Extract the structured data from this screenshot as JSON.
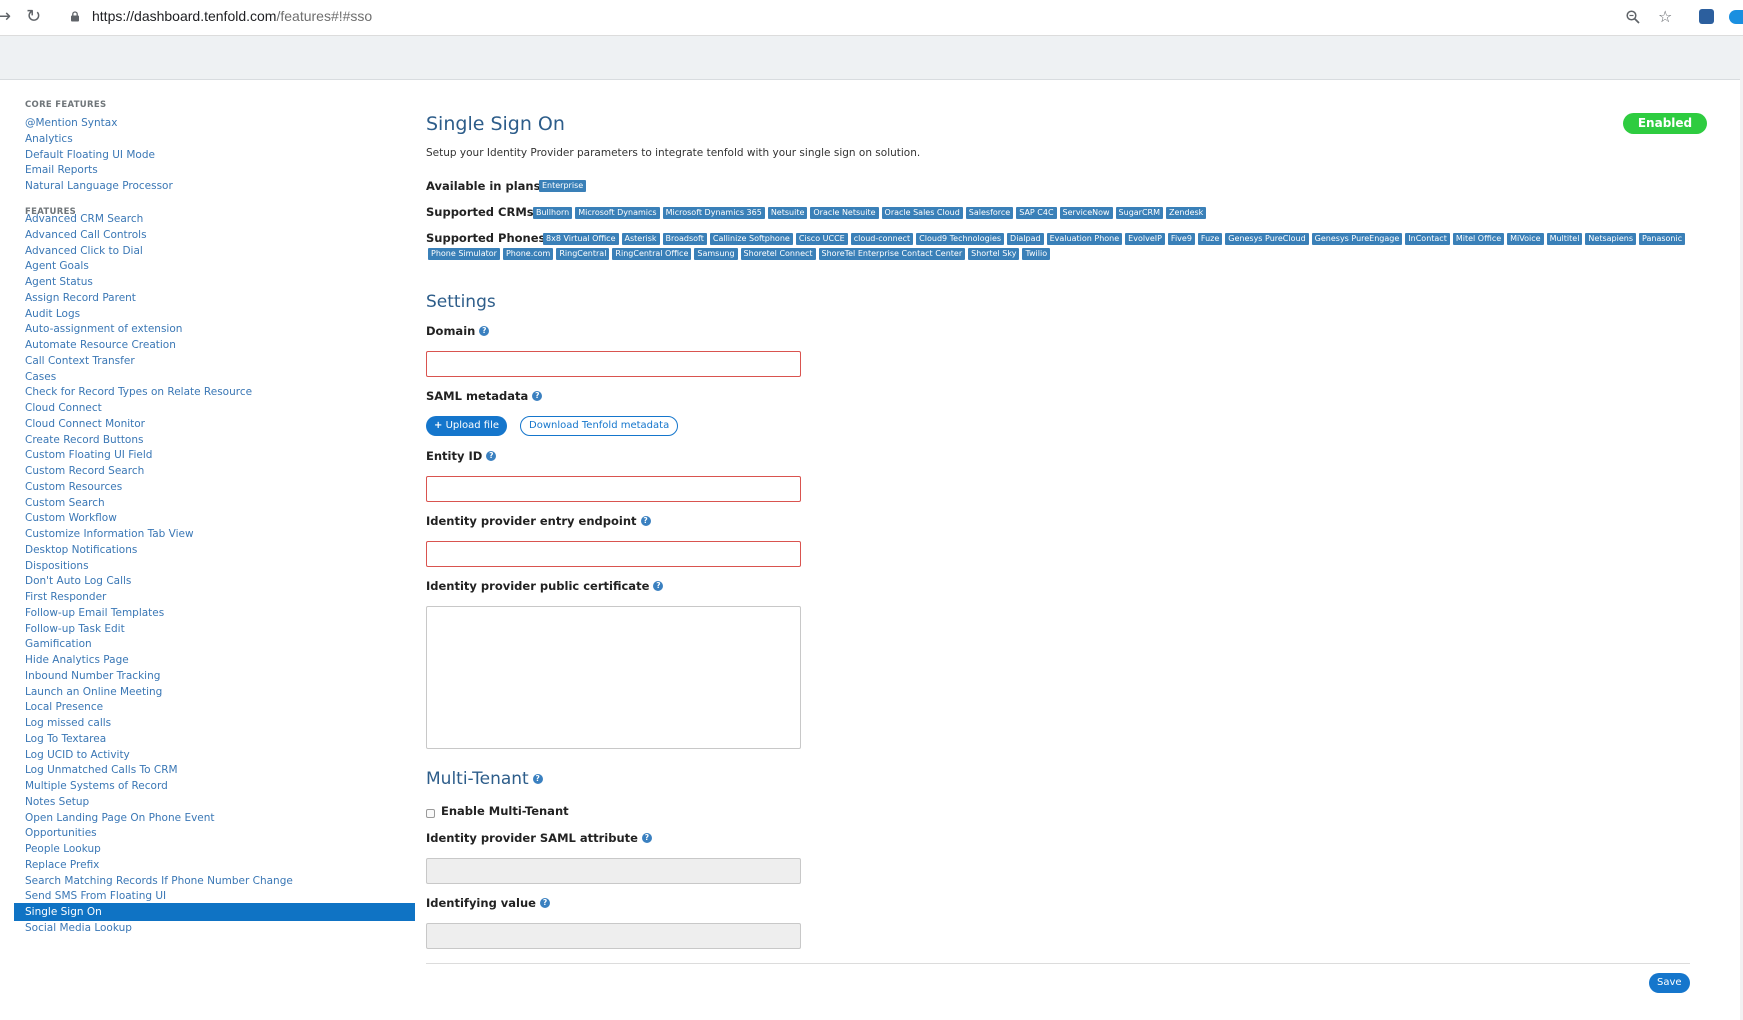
{
  "browser": {
    "url_prefix": "https://",
    "url_host": "dashboard.tenfold.com",
    "url_path": "/features#!#sso",
    "back_icon": "back-arrow-icon",
    "reload_icon": "reload-icon",
    "lock_icon": "lock-icon",
    "zoom_icon": "zoom-icon",
    "star_icon": "bookmark-star-icon"
  },
  "sidebar": {
    "core_heading": "CORE FEATURES",
    "core_items": [
      "@Mention Syntax",
      "Analytics",
      "Default Floating UI Mode",
      "Email Reports",
      "Natural Language Processor"
    ],
    "features_heading": "FEATURES",
    "feature_items": [
      "Advanced CRM Search",
      "Advanced Call Controls",
      "Advanced Click to Dial",
      "Agent Goals",
      "Agent Status",
      "Assign Record Parent",
      "Audit Logs",
      "Auto-assignment of extension",
      "Automate Resource Creation",
      "Call Context Transfer",
      "Cases",
      "Check for Record Types on Relate Resource",
      "Cloud Connect",
      "Cloud Connect Monitor",
      "Create Record Buttons",
      "Custom Floating UI Field",
      "Custom Record Search",
      "Custom Resources",
      "Custom Search",
      "Custom Workflow",
      "Customize Information Tab View",
      "Desktop Notifications",
      "Dispositions",
      "Don't Auto Log Calls",
      "First Responder",
      "Follow-up Email Templates",
      "Follow-up Task Edit",
      "Gamification",
      "Hide Analytics Page",
      "Inbound Number Tracking",
      "Launch an Online Meeting",
      "Local Presence",
      "Log missed calls",
      "Log To Textarea",
      "Log UCID to Activity",
      "Log Unmatched Calls To CRM",
      "Multiple Systems of Record",
      "Notes Setup",
      "Open Landing Page On Phone Event",
      "Opportunities",
      "People Lookup",
      "Replace Prefix",
      "Search Matching Records If Phone Number Change",
      "Send SMS From Floating UI",
      "Single Sign On",
      "Social Media Lookup"
    ],
    "active_item": "Single Sign On"
  },
  "main": {
    "title": "Single Sign On",
    "status": "Enabled",
    "description": "Setup your Identity Provider parameters to integrate tenfold with your single sign on solution.",
    "plans_label": "Available in plans:",
    "plans": [
      "Enterprise"
    ],
    "crms_label": "Supported CRMs:",
    "crms": [
      "Bullhorn",
      "Microsoft Dynamics",
      "Microsoft Dynamics 365",
      "Netsuite",
      "Oracle Netsuite",
      "Oracle Sales Cloud",
      "Salesforce",
      "SAP C4C",
      "ServiceNow",
      "SugarCRM",
      "Zendesk"
    ],
    "phones_label": "Supported Phones:",
    "phones_row1": [
      "8x8 Virtual Office",
      "Asterisk",
      "Broadsoft",
      "Callinize Softphone",
      "Cisco UCCE",
      "cloud-connect",
      "Cloud9 Technologies",
      "Dialpad",
      "Evaluation Phone",
      "EvolveIP",
      "Five9",
      "Fuze",
      "Genesys PureCloud",
      "Genesys PureEngage",
      "InContact",
      "Mitel Office",
      "MiVoice",
      "Multitel",
      "Netsapiens",
      "Panasonic"
    ],
    "phones_row2": [
      "Phone Simulator",
      "Phone.com",
      "RingCentral",
      "RingCentral Office",
      "Samsung",
      "Shoretel Connect",
      "ShoreTel Enterprise Contact Center",
      "Shortel Sky",
      "Twilio"
    ],
    "settings_heading": "Settings",
    "domain_label": "Domain",
    "saml_label": "SAML metadata",
    "upload_label": "Upload file",
    "download_label": "Download Tenfold metadata",
    "entity_label": "Entity ID",
    "endpoint_label": "Identity provider entry endpoint",
    "certificate_label": "Identity provider public certificate",
    "multitenant_heading": "Multi-Tenant",
    "enable_multitenant_label": "Enable Multi-Tenant",
    "saml_attr_label": "Identity provider SAML attribute",
    "identifying_label": "Identifying value",
    "save_label": "Save",
    "help_glyph": "?"
  },
  "colors": {
    "accent": "#1576cc",
    "tag": "#3a80b8",
    "enabled": "#2ecc40",
    "error_border": "#d9534f",
    "heading": "#2d5d8a"
  }
}
